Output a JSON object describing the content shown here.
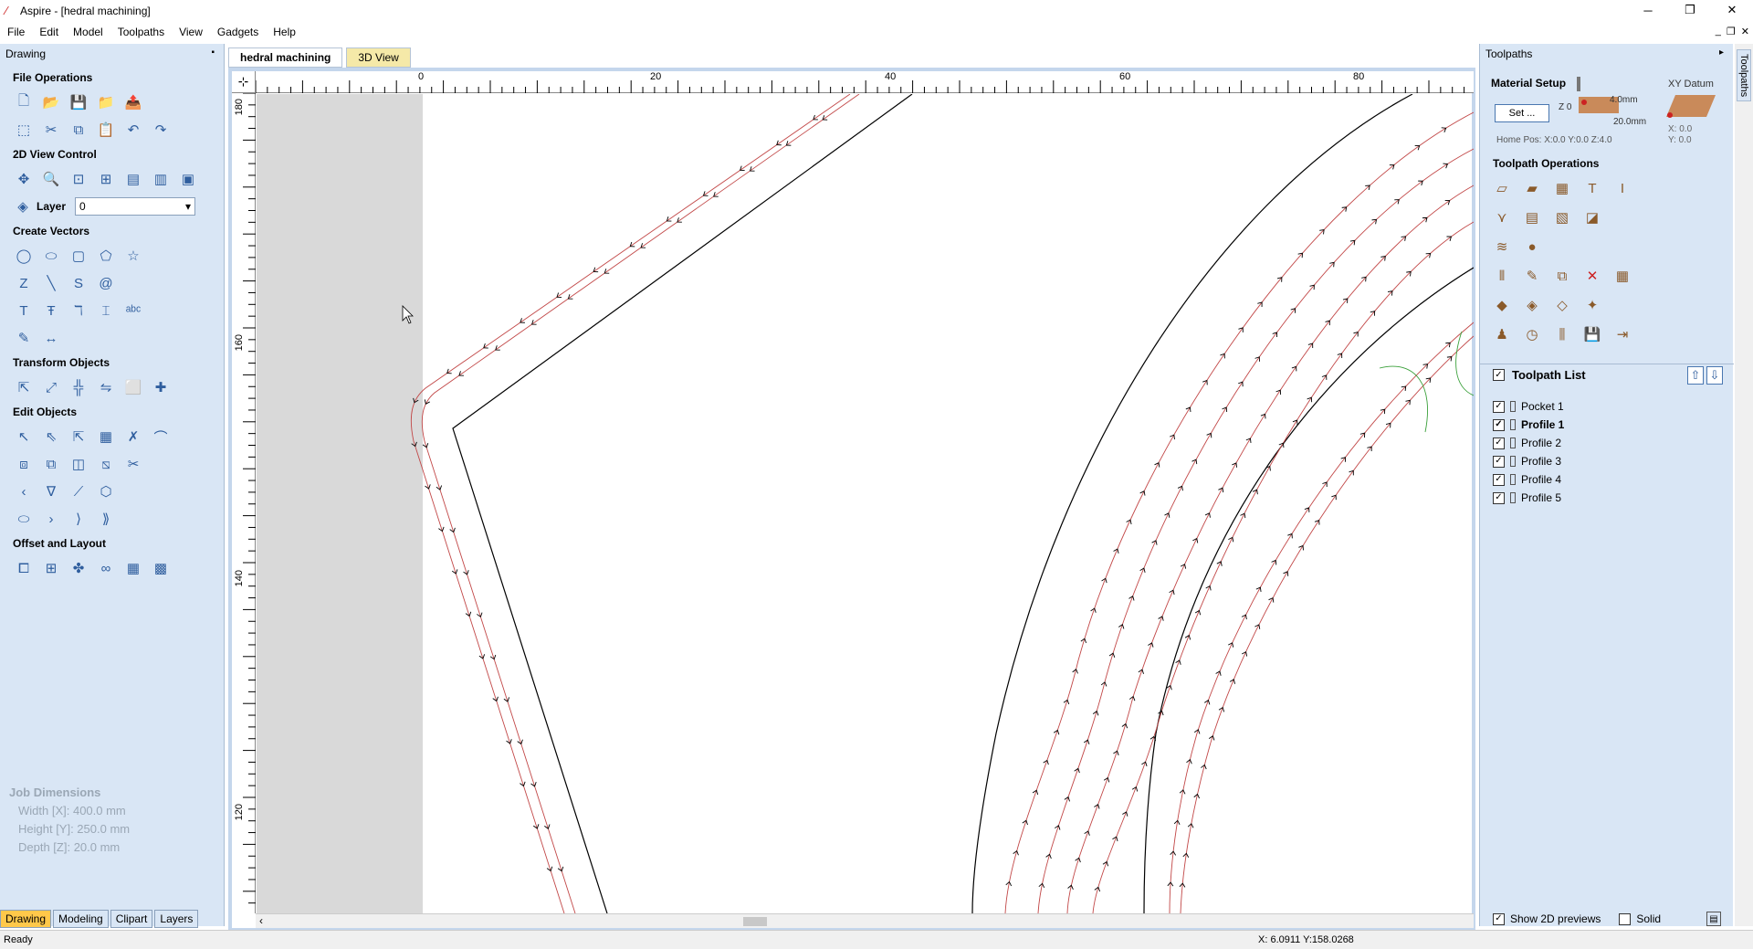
{
  "window": {
    "title": "Aspire - [hedral machining]"
  },
  "menu": [
    "File",
    "Edit",
    "Model",
    "Toolpaths",
    "View",
    "Gadgets",
    "Help"
  ],
  "left_panel": {
    "header": "Drawing",
    "sections": {
      "file_ops": "File Operations",
      "view_control": "2D View Control",
      "create_vectors": "Create Vectors",
      "transform": "Transform Objects",
      "edit_objects": "Edit Objects",
      "offset_layout": "Offset and Layout"
    },
    "layer_label": "Layer",
    "layer_value": "0",
    "job_dimensions": {
      "title": "Job Dimensions",
      "width": "Width  [X]: 400.0 mm",
      "height": "Height [Y]: 250.0 mm",
      "depth": "Depth  [Z]: 20.0 mm"
    },
    "bottom_tabs": [
      "Drawing",
      "Modeling",
      "Clipart",
      "Layers"
    ]
  },
  "doc_tabs": [
    "hedral machining",
    "3D View"
  ],
  "ruler": {
    "h_labels": [
      "0",
      "20",
      "40",
      "60",
      "80"
    ],
    "v_labels": [
      "180",
      "160",
      "140",
      "120"
    ]
  },
  "right_panel": {
    "header": "Toolpaths",
    "side_tab": "Toolpaths",
    "material_setup": "Material Setup",
    "set_button": "Set ...",
    "thickness_top": "4.0mm",
    "thickness_bottom": "20.0mm",
    "z_label": "Z 0",
    "xy_datum": "XY Datum",
    "datum_x": "X: 0.0",
    "datum_y": "Y: 0.0",
    "home_pos": "Home Pos:  X:0.0 Y:0.0 Z:4.0",
    "toolpath_ops": "Toolpath Operations",
    "toolpath_list_title": "Toolpath List",
    "toolpaths": [
      "Pocket 1",
      "Profile 1",
      "Profile 2",
      "Profile 3",
      "Profile 4",
      "Profile 5"
    ],
    "show_previews": "Show 2D previews",
    "solid": "Solid"
  },
  "status": {
    "left": "Ready",
    "coords": "X: 6.0911 Y:158.0268"
  }
}
